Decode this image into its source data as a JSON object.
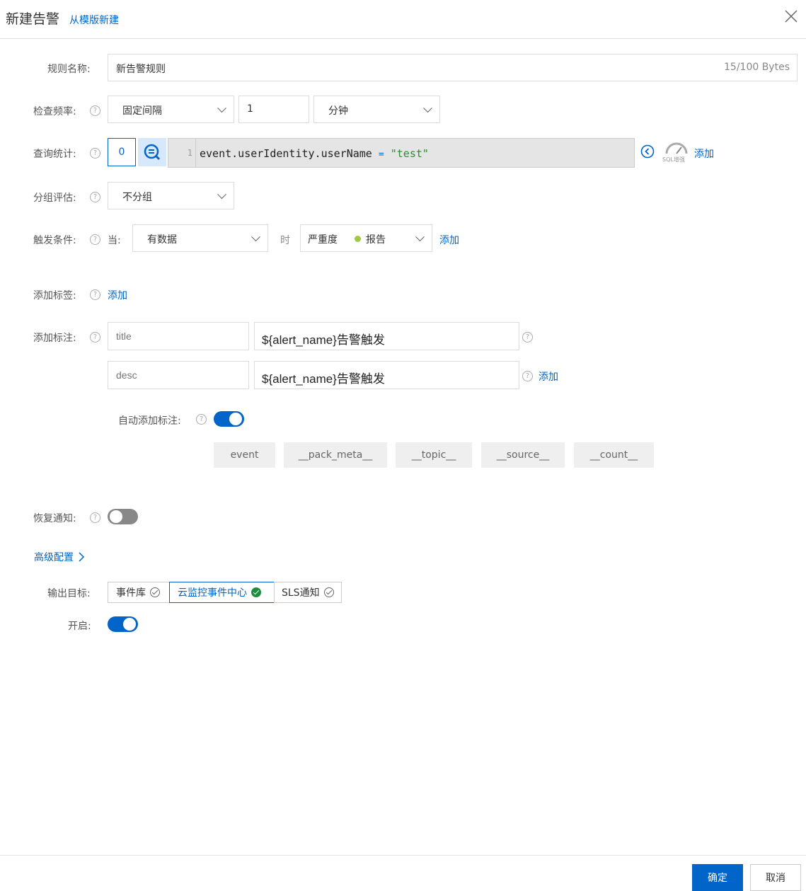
{
  "header": {
    "title": "新建告警",
    "template_link": "从模版新建"
  },
  "rule_name": {
    "label": "规则名称:",
    "value": "新告警规则",
    "counter": "15/100 Bytes"
  },
  "check_freq": {
    "label": "检查频率:",
    "mode": "固定间隔",
    "interval": "1",
    "unit": "分钟"
  },
  "query": {
    "label": "查询统计:",
    "index": "0",
    "line_no": "1",
    "code_field": "event.userIdentity.userName",
    "code_op": "=",
    "code_value": "\"test\"",
    "sql_badge": "SQL增强",
    "add_label": "添加"
  },
  "group_eval": {
    "label": "分组评估:",
    "value": "不分组"
  },
  "trigger": {
    "label": "触发条件:",
    "when": "当:",
    "condition": "有数据",
    "then": "时",
    "severity_label": "严重度",
    "severity_value": "报告",
    "severity_color": "#a0c940",
    "add_label": "添加"
  },
  "tags": {
    "label": "添加标签:",
    "add_label": "添加"
  },
  "annotations": {
    "label": "添加标注:",
    "add_label": "添加",
    "rows": [
      {
        "key_placeholder": "title",
        "value": "${alert_name}告警触发"
      },
      {
        "key_placeholder": "desc",
        "value": "${alert_name}告警触发"
      }
    ],
    "auto_label": "自动添加标注:",
    "auto_enabled": true,
    "chips": [
      "event",
      "__pack_meta__",
      "__topic__",
      "__source__",
      "__count__"
    ]
  },
  "recovery": {
    "label": "恢复通知:",
    "enabled": false
  },
  "advanced": {
    "label": "高级配置"
  },
  "output": {
    "label": "输出目标:",
    "targets": [
      "事件库",
      "云监控事件中心",
      "SLS通知"
    ],
    "selected": "云监控事件中心"
  },
  "enable": {
    "label": "开启:",
    "enabled": true
  },
  "footer": {
    "confirm": "确定",
    "cancel": "取消"
  },
  "colors": {
    "accent": "#0064c8",
    "success": "#1e8e3e"
  }
}
